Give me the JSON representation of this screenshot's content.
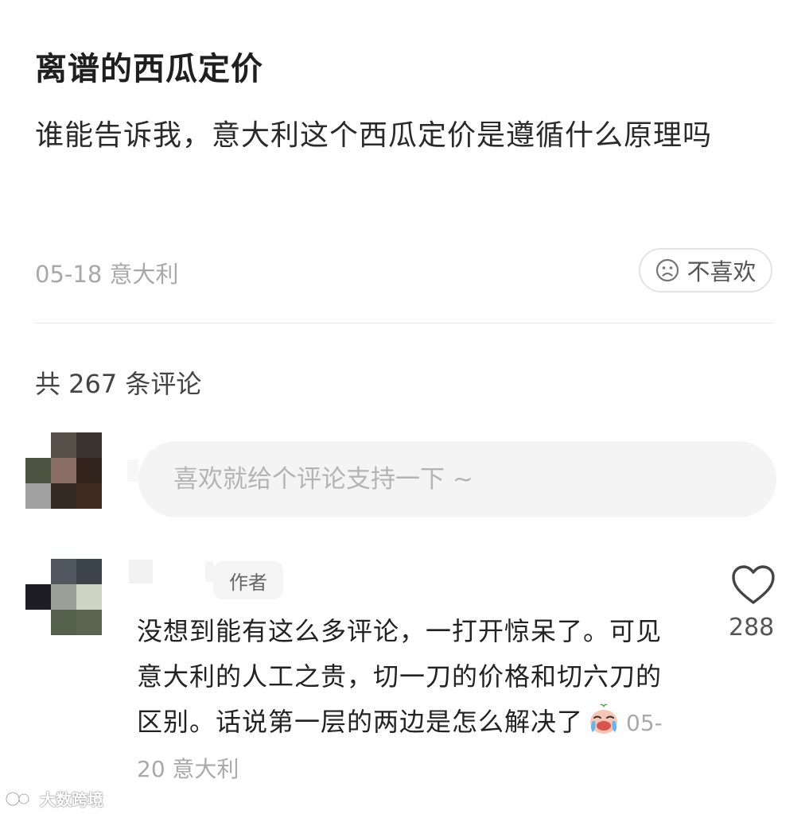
{
  "post": {
    "title": "离谱的西瓜定价",
    "body": "谁能告诉我，意大利这个西瓜定价是遵循什么原理吗",
    "meta": "05-18 意大利",
    "dislike_label": "不喜欢"
  },
  "comments_section": {
    "count_label": "共 267 条评论",
    "input_placeholder": "喜欢就给个评论支持一下 ~"
  },
  "comment": {
    "author_badge": "作者",
    "text": "没想到能有这么多评论，一打开惊呆了。可见意大利的人工之贵，切一刀的价格和切六刀的区别。话说第一层的两边是怎么解决了",
    "meta": "05-20 意大利",
    "like_count": "288"
  },
  "watermark": {
    "text": "大数跨境"
  },
  "icons": {
    "dislike": "frown-face-icon",
    "like": "heart-outline-icon",
    "emoji": "crying-face-emoji-icon",
    "watermark_logo": "brand-logo-icon"
  },
  "colors": {
    "muted_text": "#a8a8a8",
    "input_bg": "#f4f4f4",
    "badge_bg": "#f5f5f5",
    "divider": "#ebebeb"
  }
}
